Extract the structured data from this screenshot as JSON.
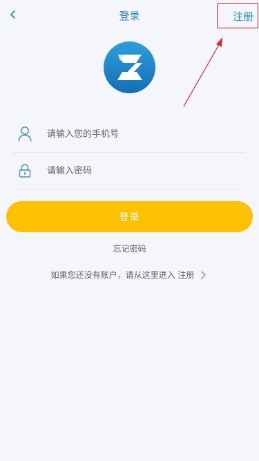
{
  "nav": {
    "title": "登录",
    "register": "注册",
    "back_icon": "chevron-left-icon"
  },
  "form": {
    "phone_placeholder": "请输入您的手机号",
    "password_placeholder": "请输入密码",
    "user_icon": "user-icon",
    "lock_icon": "lock-icon"
  },
  "actions": {
    "login": "登录",
    "forgot_password": "忘记密码",
    "register_hint": "如果您还没有账户，请从这里进入 注册"
  },
  "colors": {
    "accent": "#2a86c6",
    "button": "#fec001",
    "annotation": "#e02b2b",
    "background": "#f5f6fb"
  }
}
